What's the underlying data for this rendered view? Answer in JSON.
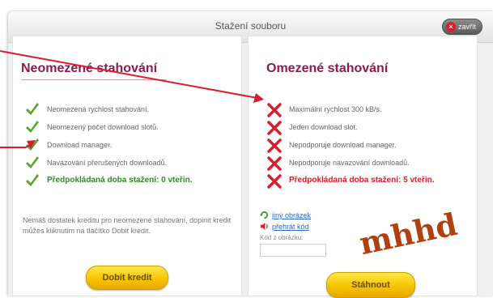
{
  "dialog": {
    "title": "Stažení souboru",
    "close_label": "zavřít"
  },
  "left_panel": {
    "title": "Neomezené stahování",
    "features": [
      "Neomezená rychlost stahování.",
      "Neomezený počet download slotů.",
      "Download manager.",
      "Navazování přerušených downloadů.",
      "Předpokládaná doba stažení: 0 vteřin."
    ],
    "note": "Nemáš dostatek kreditu pro neomezené stahování, dopinit kredit můžes kliknutim na tlačítko Dobit kredit.",
    "button_label": "Dobit kredit"
  },
  "right_panel": {
    "title": "Omezené stahování",
    "limitations": [
      "Maximální rychlost 300 kB/s.",
      "Jeden download slot.",
      "Nepodporuje download manager.",
      "Nepodporuje navazování downloadů.",
      "Předpokládaná doba stažení: 5 vteřin."
    ],
    "captcha": {
      "other_image_link": "jiný obrázek",
      "play_code_link": "přehrát kód",
      "input_label": "Kód z obrázku:",
      "input_value": "",
      "image_text": "mhhd"
    },
    "button_label": "Stáhnout"
  },
  "colors": {
    "title": "#8a1c4e",
    "check": "#5aa52f",
    "cross": "#d81e2c",
    "strong_green": "#2f8a28",
    "strong_red": "#d0202a",
    "arrow": "#d81e2c",
    "button_yellow": "#f7c400",
    "link": "#2a6bb8"
  },
  "icons": {
    "feature": "check-icon",
    "limitation": "cross-icon",
    "close": "close-icon",
    "refresh": "refresh-icon",
    "speaker": "speaker-icon"
  }
}
